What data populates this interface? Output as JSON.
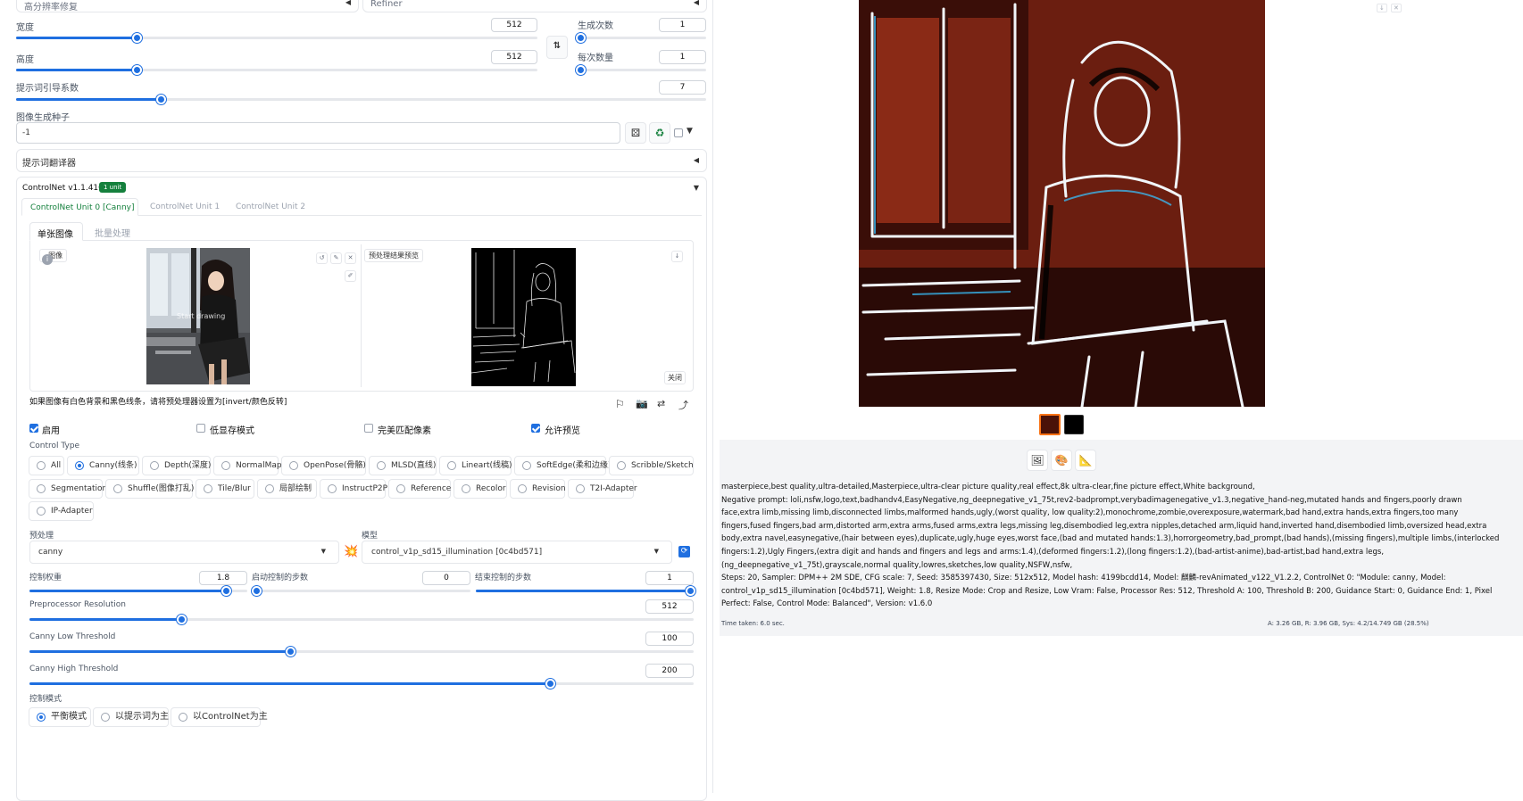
{
  "top": {
    "hires_label": "高分辨率修复",
    "refiner_label": "Refiner"
  },
  "width": {
    "label": "宽度",
    "value": "512",
    "fraction": 0.232
  },
  "height": {
    "label": "高度",
    "value": "512",
    "fraction": 0.232
  },
  "batch_count": {
    "label": "生成次数",
    "value": "1",
    "fraction": 0.0
  },
  "batch_size": {
    "label": "每次数量",
    "value": "1",
    "fraction": 0.0
  },
  "cfg": {
    "label": "提示词引导系数",
    "value": "7",
    "fraction": 0.21
  },
  "seed": {
    "label": "图像生成种子",
    "value": "-1"
  },
  "prompt_translator": {
    "label": "提示词翻译器"
  },
  "controlnet": {
    "title": "ControlNet v1.1.410",
    "badge": "1 unit",
    "tabs": [
      "ControlNet Unit 0 [Canny]",
      "ControlNet Unit 1",
      "ControlNet Unit 2"
    ],
    "subtabs": [
      "单张图像",
      "批量处理"
    ],
    "image_label": "图像",
    "start_drawing": "Start drawing",
    "preview_label": "预处理结果预览",
    "close_label": "关闭",
    "hint": "如果图像有白色背景和黑色线条，请将预处理器设置为[invert/颜色反转]",
    "checkboxes": [
      {
        "label": "启用",
        "checked": true
      },
      {
        "label": "低显存模式",
        "checked": false
      },
      {
        "label": "完美匹配像素",
        "checked": false
      },
      {
        "label": "允许预览",
        "checked": true
      }
    ],
    "control_type_label": "Control Type",
    "control_types_row1": [
      "All",
      "Canny(线条)",
      "Depth(深度)",
      "NormalMap",
      "OpenPose(骨骼)",
      "MLSD(直线)",
      "Lineart(线稿)",
      "SoftEdge(柔和边缘)",
      "Scribble/Sketch"
    ],
    "control_types_row2": [
      "Segmentation",
      "Shuffle(图像打乱)",
      "Tile/Blur",
      "局部绘制",
      "InstructP2P",
      "Reference",
      "Recolor",
      "Revision",
      "T2I-Adapter"
    ],
    "control_types_row3": [
      "IP-Adapter"
    ],
    "selected_type": "Canny(线条)",
    "preprocessor_label": "预处理",
    "preprocessor_value": "canny",
    "model_label": "模型",
    "model_value": "control_v1p_sd15_illumination [0c4bd571]",
    "weight": {
      "label": "控制权重",
      "value": "1.8",
      "fraction": 0.9
    },
    "start_step": {
      "label": "启动控制的步数",
      "value": "0",
      "fraction": 0.0
    },
    "end_step": {
      "label": "结束控制的步数",
      "value": "1",
      "fraction": 1.0
    },
    "pp_res": {
      "label": "Preprocessor Resolution",
      "value": "512",
      "fraction": 0.229
    },
    "low_th": {
      "label": "Canny Low Threshold",
      "value": "100",
      "fraction": 0.392
    },
    "high_th": {
      "label": "Canny High Threshold",
      "value": "200",
      "fraction": 0.784
    },
    "mode_label": "控制模式",
    "modes": [
      "平衡模式",
      "以提示词为主",
      "以ControlNet为主"
    ],
    "selected_mode": "平衡模式"
  },
  "output": {
    "info_lines": [
      "masterpiece,best quality,ultra-detailed,Masterpiece,ultra-clear picture quality,real effect,8k ultra-clear,fine picture effect,White background,",
      "Negative prompt: loli,nsfw,logo,text,badhandv4,EasyNegative,ng_deepnegative_v1_75t,rev2-badprompt,verybadimagenegative_v1.3,negative_hand-neg,mutated hands and fingers,poorly drawn",
      "face,extra limb,missing limb,disconnected limbs,malformed hands,ugly,(worst quality, low quality:2),monochrome,zombie,overexposure,watermark,bad hand,extra hands,extra fingers,too many",
      "fingers,fused fingers,bad arm,distorted arm,extra arms,fused arms,extra legs,missing leg,disembodied leg,extra nipples,detached arm,liquid hand,inverted hand,disembodied limb,oversized head,extra",
      "body,extra navel,easynegative,(hair between eyes),duplicate,ugly,huge eyes,worst face,(bad and mutated hands:1.3),horrorgeometry,bad_prompt,(bad hands),(missing fingers),multiple limbs,(interlocked",
      "fingers:1.2),Ugly Fingers,(extra digit and hands and fingers and legs and arms:1.4),(deformed fingers:1.2),(long fingers:1.2),(bad-artist-anime),bad-artist,bad hand,extra legs,",
      "(ng_deepnegative_v1_75t),grayscale,normal quality,lowres,sketches,low quality,NSFW,nsfw,",
      "Steps: 20, Sampler: DPM++ 2M SDE, CFG scale: 7, Seed: 3585397430, Size: 512x512, Model hash: 4199bcdd14, Model: 麒麟-revAnimated_v122_V1.2.2, ControlNet 0: \"Module: canny, Model:",
      "control_v1p_sd15_illumination [0c4bd571], Weight: 1.8, Resize Mode: Crop and Resize, Low Vram: False, Processor Res: 512, Threshold A: 100, Threshold B: 200, Guidance Start: 0, Guidance End: 1, Pixel",
      "Perfect: False, Control Mode: Balanced\", Version: v1.6.0"
    ],
    "time_taken": "Time taken: 6.0 sec.",
    "vram": "A: 3.26 GB, R: 3.96 GB, Sys: 4.2/14.749 GB (28.5%)"
  },
  "colors": {
    "accent": "#1f6fe0",
    "badge": "#15803d",
    "tab_active": "#15803d"
  }
}
